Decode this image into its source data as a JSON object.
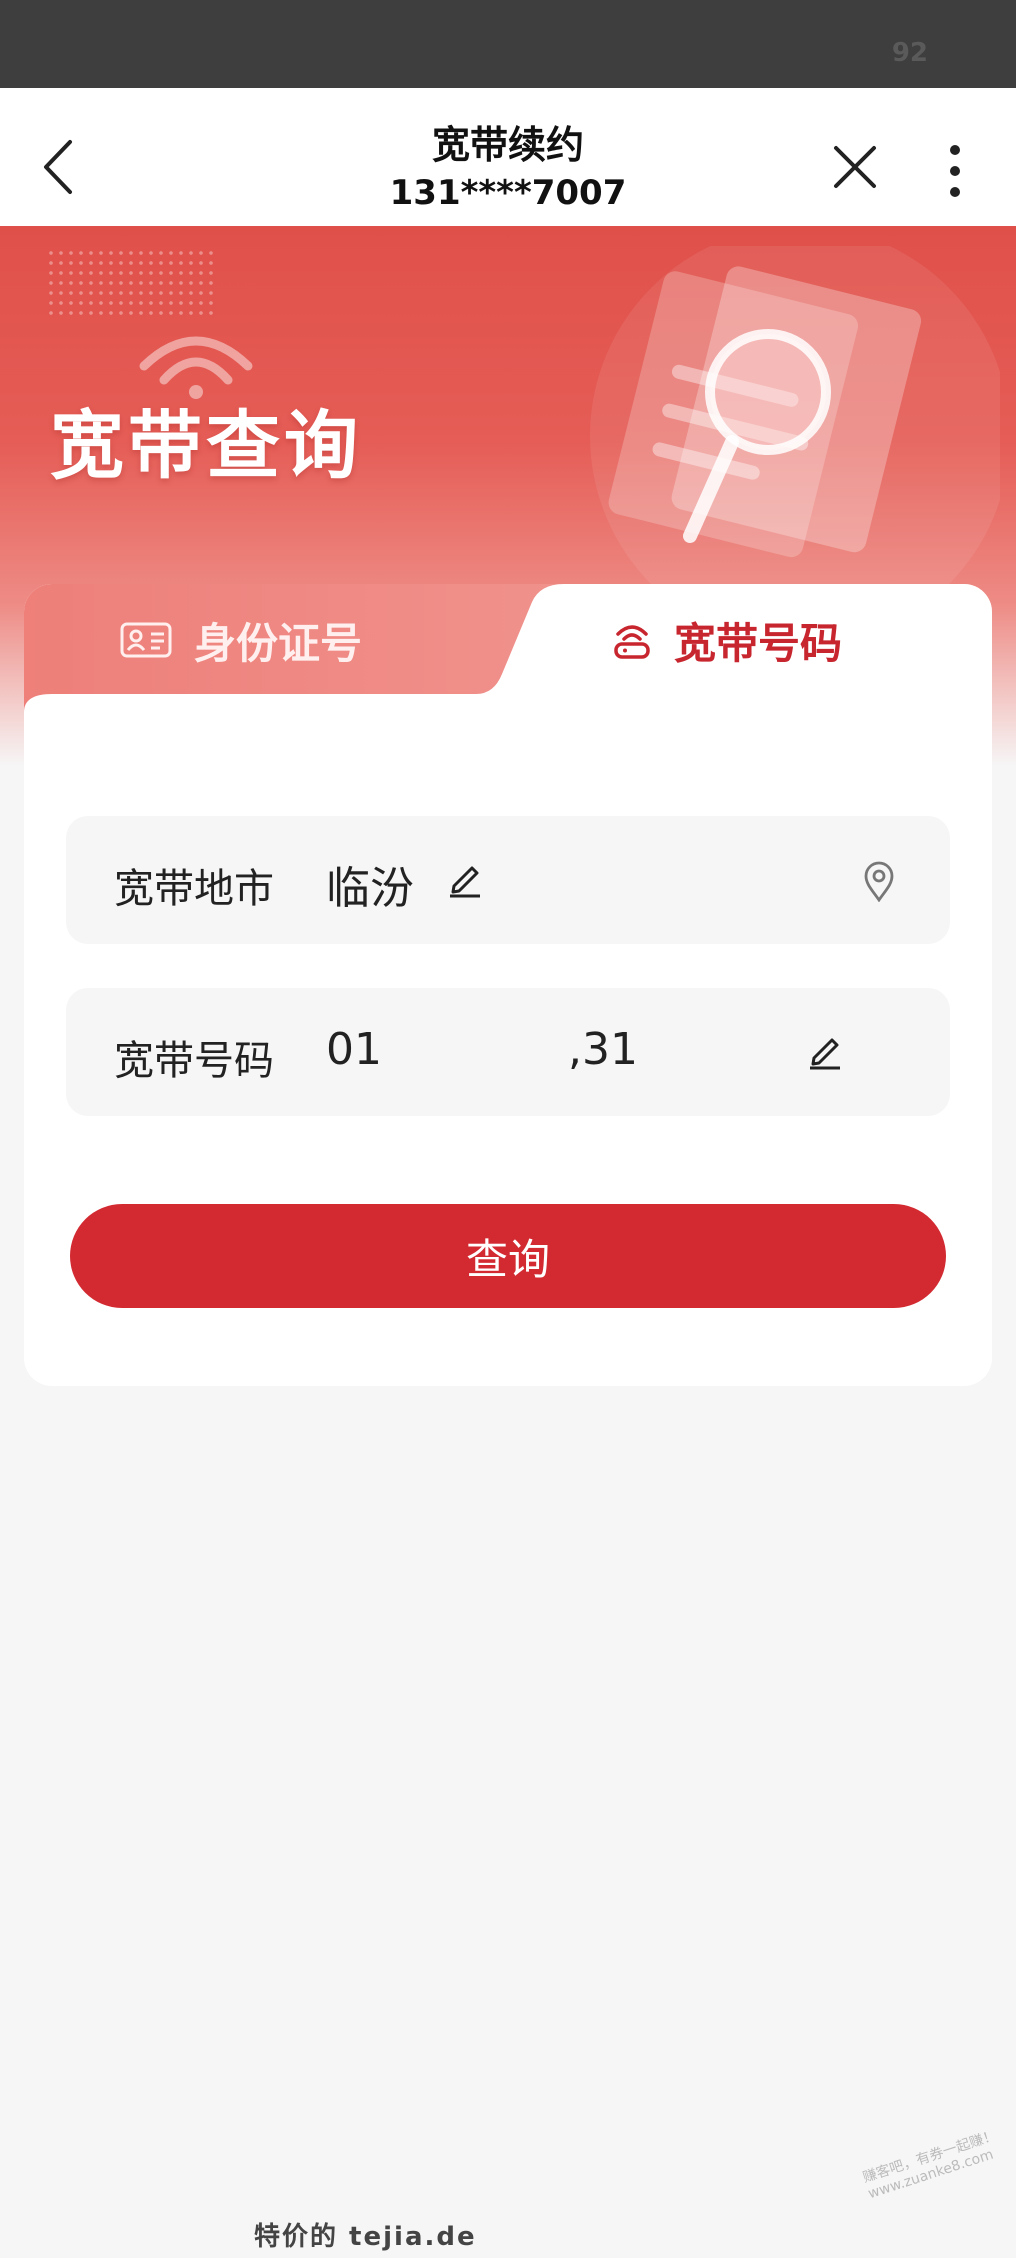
{
  "status_bar": {
    "battery": "92"
  },
  "nav": {
    "title": "宽带续约",
    "subtitle": "131****7007"
  },
  "banner": {
    "title": "宽带查询"
  },
  "tabs": [
    {
      "label": "身份证号",
      "icon": "id-card-icon",
      "active": false
    },
    {
      "label": "宽带号码",
      "icon": "broadband-router-icon",
      "active": true
    }
  ],
  "form": {
    "city": {
      "label": "宽带地市",
      "value": "临汾"
    },
    "number": {
      "label": "宽带号码",
      "value_start": "01",
      "value_end": ",31"
    }
  },
  "query_button": {
    "label": "查询"
  },
  "watermark": {
    "text": "特价的  tejia.de",
    "corner_text": "赚客吧，有券一起赚！www.zuanke8.com"
  },
  "colors": {
    "accent": "#d32a32",
    "banner": "#e0504a",
    "background": "#f6f6f6"
  }
}
